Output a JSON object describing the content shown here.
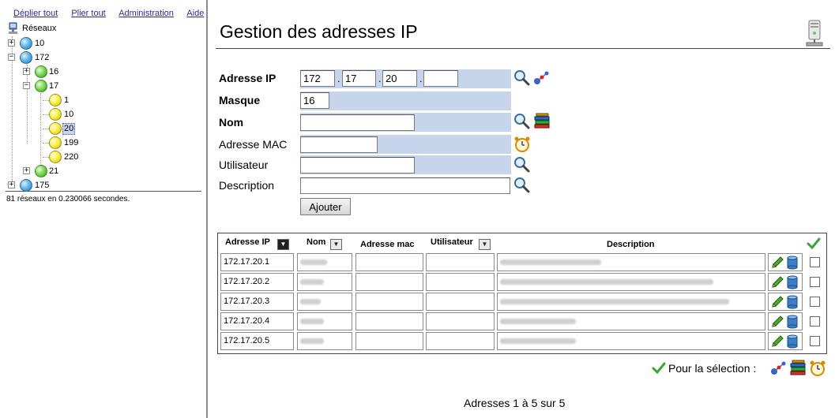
{
  "left": {
    "nav": [
      "Déplier tout",
      "Plier tout",
      "Administration",
      "Aide"
    ],
    "tree": {
      "root": "Réseaux",
      "nodes": [
        "10",
        "172",
        "16",
        "17",
        "1",
        "10",
        "20",
        "199",
        "220",
        "21",
        "175"
      ]
    },
    "stats": "81 réseaux en 0.230066 secondes."
  },
  "right": {
    "title": "Gestion des adresses IP",
    "form": {
      "ip_label": "Adresse IP",
      "ip_values": [
        "172",
        "17",
        "20",
        ""
      ],
      "mask_label": "Masque",
      "mask_value": "16",
      "name_label": "Nom",
      "name_value": "",
      "mac_label": "Adresse MAC",
      "mac_value": "",
      "user_label": "Utilisateur",
      "user_value": "",
      "desc_label": "Description",
      "desc_value": "",
      "add_button": "Ajouter",
      "ip_separator": "."
    },
    "table": {
      "headers": [
        "Adresse IP",
        "Nom",
        "Adresse mac",
        "Utilisateur",
        "Description"
      ],
      "rows": [
        {
          "ip": "172.17.20.1"
        },
        {
          "ip": "172.17.20.2"
        },
        {
          "ip": "172.17.20.3"
        },
        {
          "ip": "172.17.20.4"
        },
        {
          "ip": "172.17.20.5"
        }
      ]
    },
    "selection_label": "Pour la sélection :",
    "pager": "Adresses 1 à 5 sur 5"
  },
  "colors": {
    "band": "#c6d4ec",
    "link": "#2a2aa8",
    "selected": "#c6d4ef"
  },
  "icons": [
    "search-icon",
    "molecule-icon",
    "books-icon",
    "alarm-clock-icon",
    "pencil-icon",
    "database-icon",
    "checkmark-icon",
    "server-icon",
    "network-icon"
  ]
}
